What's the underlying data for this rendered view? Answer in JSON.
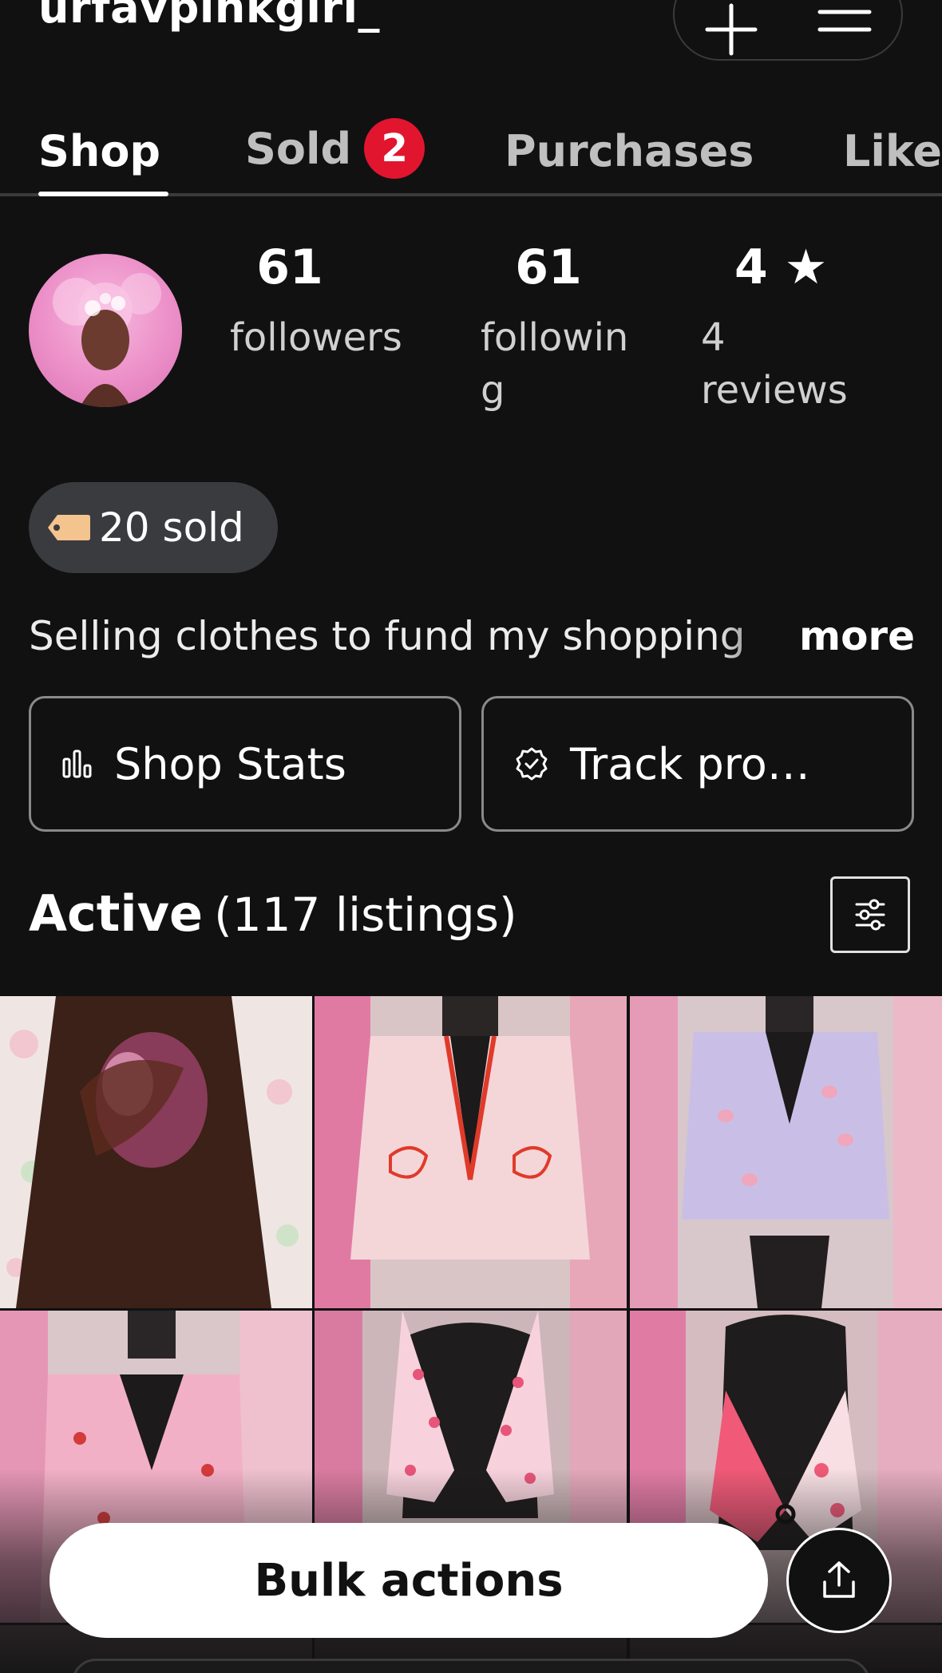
{
  "header": {
    "username": "urfavpinkgirl_",
    "add_icon": "plus-icon",
    "menu_icon": "hamburger-menu-icon"
  },
  "tabs": [
    {
      "label": "Shop",
      "active": true
    },
    {
      "label": "Sold",
      "badge": "2"
    },
    {
      "label": "Purchases"
    },
    {
      "label": "Likes"
    }
  ],
  "profile": {
    "followers": {
      "count": "61",
      "label": "followers"
    },
    "following": {
      "count": "61",
      "label": "following"
    },
    "rating": {
      "value": "4",
      "star": "★",
      "reviews": "4 reviews"
    }
  },
  "sold_chip": {
    "icon": "price-tag-icon",
    "label": "20 sold"
  },
  "bio": {
    "text": "Selling clothes to fund my shopping",
    "more": "more"
  },
  "actions": {
    "shop_stats": {
      "icon": "bar-chart-icon",
      "label": "Shop Stats"
    },
    "track_progress": {
      "icon": "verified-badge-icon",
      "label": "Track pro…"
    }
  },
  "listings": {
    "title": "Active",
    "count_text": "(117 listings)",
    "filter_icon": "sliders-icon"
  },
  "bottom": {
    "bulk_label": "Bulk actions",
    "share_icon": "share-upload-icon"
  },
  "colors": {
    "background": "#111112",
    "badge_red": "#e2152f",
    "chip_gray": "#3a3b3e"
  }
}
